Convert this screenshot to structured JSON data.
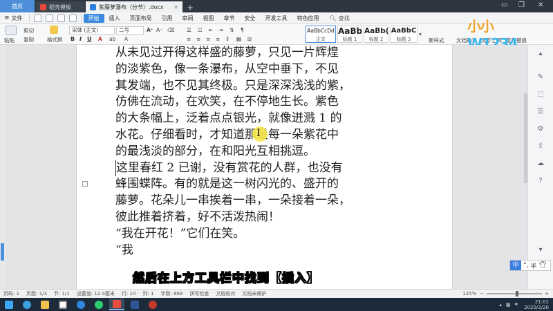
{
  "tabs": {
    "home": "首页",
    "template": "稻壳模板",
    "document": "紫藤萝瀑布（分节）.docx",
    "new_tab": "+"
  },
  "menu": {
    "file": "文件",
    "items": [
      "开始",
      "插入",
      "页面布局",
      "引用",
      "审阅",
      "视图",
      "章节",
      "安全",
      "开发工具",
      "特色应用"
    ],
    "search": "查找"
  },
  "ribbon": {
    "paste": "粘贴",
    "cut": "剪切",
    "copy": "复制",
    "format_painter": "格式刷",
    "font_name": "宋体 (正文)",
    "font_size": "二号",
    "bold": "B",
    "italic": "I",
    "underline": "U",
    "styles": [
      {
        "preview": "AaBbCcDd",
        "caption": "正文"
      },
      {
        "preview": "AaBb",
        "caption": "标题 1"
      },
      {
        "preview": "AaBb(",
        "caption": "标题 2"
      },
      {
        "preview": "AaBbC",
        "caption": "标题 3"
      }
    ],
    "new_style": "新样式",
    "doc_helper": "文档助手",
    "text_tools": "文字工具",
    "find_replace": "查找替换"
  },
  "logo": {
    "part1": "小小",
    "part2": "W1234"
  },
  "document": {
    "lines": [
      "从未见过开得这样盛的藤萝，只见一片辉煌",
      "的淡紫色，像一条瀑布，从空中垂下，不见",
      "其发端，也不见其终极。只是深深浅浅的紫，",
      "仿佛在流动，在欢笑，在不停地生长。紫色",
      "的大条幅上，泛着点点银光，就像迸溅 1 的",
      "水花。仔细看时，才知道那是每一朵紫花中",
      "的最浅淡的部分，在和阳光互相挑逗。",
      "这里春红 2 已谢，没有赏花的人群，也没有",
      "蜂围蝶阵。有的就是这一树闪光的、盛开的",
      "藤萝。花朵儿一串挨着一串，一朵接着一朵，",
      "彼此推着挤着，好不活泼热闹！",
      "“我在开花！”它们在笑。",
      "“我"
    ]
  },
  "caption": "然后在上方工具栏中找到【插入】",
  "ime": {
    "mode": "中",
    "punct": "°,",
    "width": "半"
  },
  "status": {
    "page": "页码: 1",
    "pages": "页面: 1/3",
    "section": "节: 1/1",
    "setting": "设置值: 12.4厘米",
    "row": "行: 10",
    "col": "列: 1",
    "words": "字数: 868",
    "spell": "拼写检查",
    "proof": "文档校对",
    "protect": "文档未保护",
    "zoom": "125%",
    "zoom_level": 0.55
  },
  "clock": {
    "time": "21:01",
    "date": "2020/2/20"
  }
}
